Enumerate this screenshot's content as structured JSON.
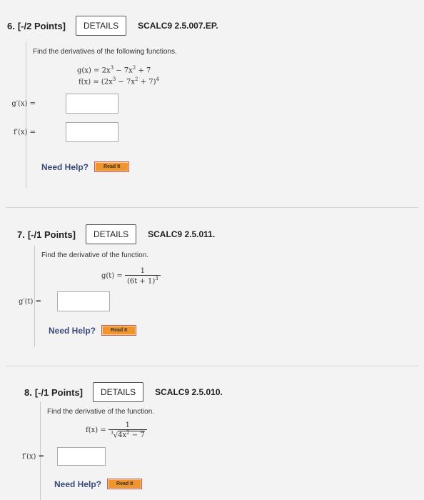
{
  "q6": {
    "number": "6.",
    "points": "[-/2 Points]",
    "details_label": "DETAILS",
    "code": "SCALC9 2.5.007.EP.",
    "prompt": "Find the derivatives of the following functions.",
    "eq1": {
      "lhs": "g(x) = 2x",
      "exp1": "3",
      "mid": " − 7x",
      "exp2": "2",
      "rhs": " + 7"
    },
    "eq2": {
      "lhs": "f(x) = (2x",
      "exp1": "3",
      "mid": " − 7x",
      "exp2": "2",
      "rhs": " + 7)",
      "exp3": "4"
    },
    "answers": [
      {
        "label": "g′(x) ="
      },
      {
        "label": "f′(x) ="
      }
    ],
    "help_label": "Need Help?",
    "read_label": "Read It"
  },
  "q7": {
    "number": "7.",
    "points": "[-/1 Points]",
    "details_label": "DETAILS",
    "code": "SCALC9 2.5.011.",
    "prompt": "Find the derivative of the function.",
    "eq": {
      "lhs": "g(t) =",
      "num": "1",
      "den": "(6t + 1)",
      "den_exp": "3"
    },
    "answer_label": "g′(t) =",
    "help_label": "Need Help?",
    "read_label": "Read It"
  },
  "q8": {
    "number": "8.",
    "points": "[-/1 Points]",
    "details_label": "DETAILS",
    "code": "SCALC9 2.5.010.",
    "prompt": "Find the derivative of the function.",
    "eq": {
      "lhs": "f(x) =",
      "num": "1",
      "root_index": "3",
      "radicand": "4x",
      "rad_exp": "2",
      "rad_rest": " − 7"
    },
    "answer_label": "f′(x) =",
    "help_label": "Need Help?",
    "read_label": "Read It"
  }
}
